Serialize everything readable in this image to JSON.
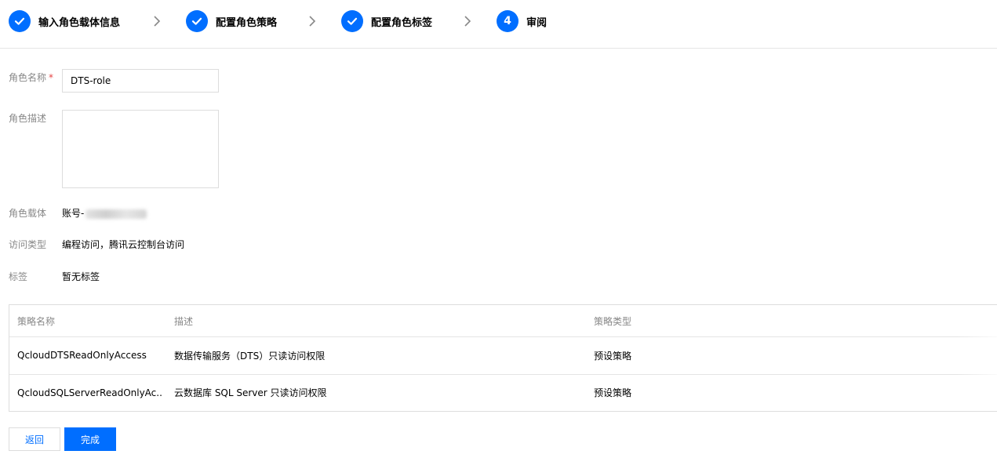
{
  "steps": [
    {
      "label": "输入角色载体信息",
      "state": "done"
    },
    {
      "label": "配置角色策略",
      "state": "done"
    },
    {
      "label": "配置角色标签",
      "state": "done"
    },
    {
      "label": "审阅",
      "state": "current",
      "number": "4"
    }
  ],
  "form": {
    "role_name_label": "角色名称",
    "required_mark": "*",
    "role_name_value": "DTS-role",
    "role_desc_label": "角色描述",
    "role_desc_value": "",
    "carrier_label": "角色载体",
    "carrier_value_prefix": "账号-",
    "access_type_label": "访问类型",
    "access_type_value": "编程访问，腾讯云控制台访问",
    "tags_label": "标签",
    "tags_value": "暂无标签"
  },
  "policy_table": {
    "headers": [
      "策略名称",
      "描述",
      "策略类型"
    ],
    "rows": [
      {
        "name": "QcloudDTSReadOnlyAccess",
        "desc": "数据传输服务（DTS）只读访问权限",
        "type": "预设策略"
      },
      {
        "name": "QcloudSQLServerReadOnlyAc...",
        "desc": "云数据库 SQL Server 只读访问权限",
        "type": "预设策略"
      }
    ]
  },
  "buttons": {
    "back": "返回",
    "done": "完成"
  },
  "colors": {
    "primary": "#006eff",
    "label_gray": "#888888",
    "required": "#e54545"
  }
}
